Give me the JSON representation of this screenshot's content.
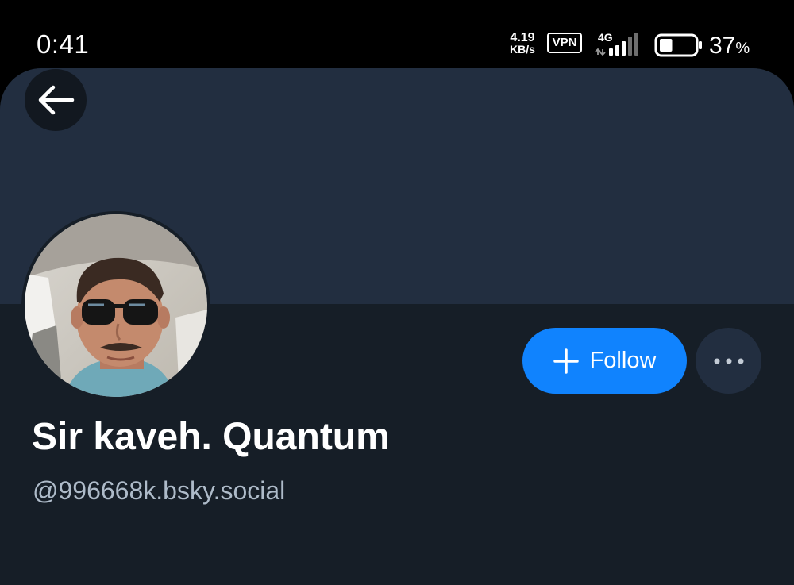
{
  "status_bar": {
    "time": "0:41",
    "net_speed_value": "4.19",
    "net_speed_unit": "KB/s",
    "vpn_label": "VPN",
    "network_type": "4G",
    "battery_percent": "37",
    "battery_percent_sign": "%",
    "battery_level": 0.37
  },
  "profile": {
    "back_icon": "arrow-left-icon",
    "follow_label": "Follow",
    "follow_icon": "plus-icon",
    "more_icon": "ellipsis-icon",
    "display_name": "Sir kaveh. Quantum",
    "handle": "@996668k.bsky.social"
  },
  "colors": {
    "banner": "#222e40",
    "background": "#161e27",
    "accent": "#1083fe",
    "handle_text": "#aebbc9"
  }
}
